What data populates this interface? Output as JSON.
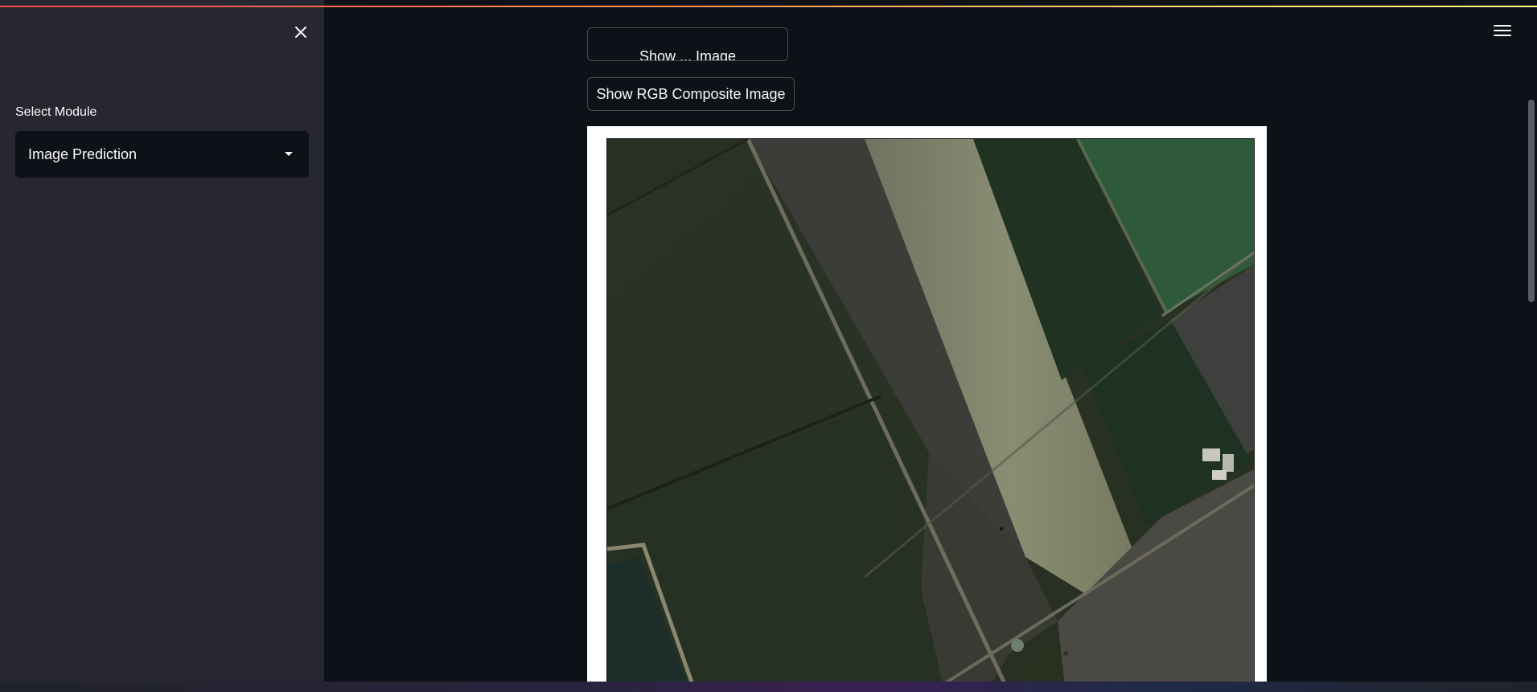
{
  "sidebar": {
    "select_label": "Select Module",
    "select_value": "Image Prediction"
  },
  "main": {
    "top_button_label": "Show ... Image",
    "rgb_button_label": "Show RGB Composite Image"
  },
  "icons": {
    "close": "close-icon",
    "menu": "hamburger-menu-icon",
    "dropdown": "chevron-down-icon"
  },
  "colors": {
    "app_bg": "#0e1117",
    "sidebar_bg": "#262730",
    "text": "#fafafa",
    "accent_gradient_start": "#ff4b4b",
    "accent_gradient_end": "#fffd80"
  }
}
